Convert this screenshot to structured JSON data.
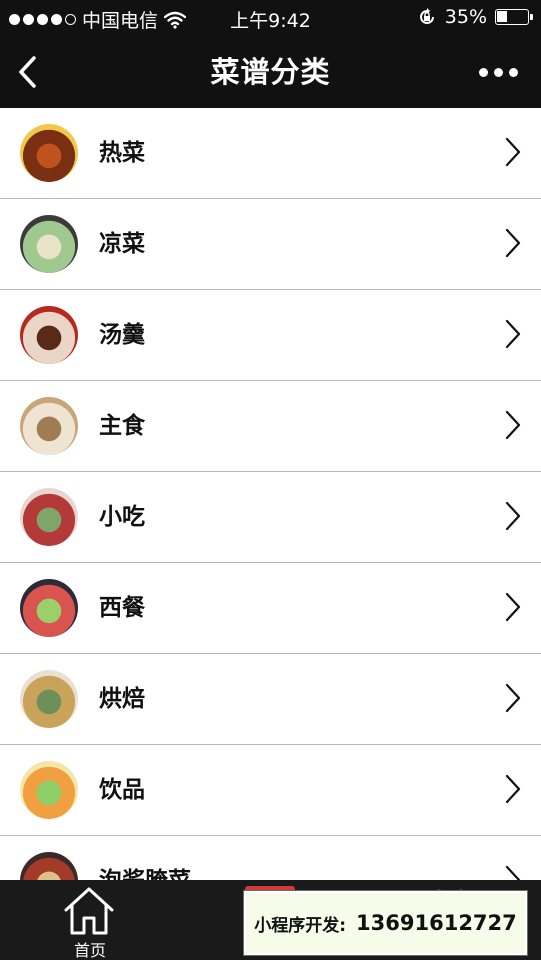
{
  "status_bar": {
    "carrier": "中国电信",
    "time": "上午9:42",
    "battery": "35%",
    "battery_level": 0.35
  },
  "nav": {
    "title": "菜谱分类",
    "back_icon": "chevron-left-icon",
    "more_icon": "more-dots-icon"
  },
  "categories": [
    {
      "label": "热菜",
      "thumb_colors": [
        "#f2c84b",
        "#7a2e12",
        "#c0521e"
      ]
    },
    {
      "label": "凉菜",
      "thumb_colors": [
        "#3b3b3b",
        "#9fc98f",
        "#e9e4c7"
      ]
    },
    {
      "label": "汤羹",
      "thumb_colors": [
        "#b8281d",
        "#e9d6c7",
        "#5a2a18"
      ]
    },
    {
      "label": "主食",
      "thumb_colors": [
        "#c9a57a",
        "#efe4d2",
        "#a07c52"
      ]
    },
    {
      "label": "小吃",
      "thumb_colors": [
        "#e8d7d0",
        "#b43a3a",
        "#7fa66a"
      ]
    },
    {
      "label": "西餐",
      "thumb_colors": [
        "#2b2b3b",
        "#d9534f",
        "#9ccf6a"
      ]
    },
    {
      "label": "烘焙",
      "thumb_colors": [
        "#e8e0d0",
        "#c9a35a",
        "#6e8f5a"
      ]
    },
    {
      "label": "饮品",
      "thumb_colors": [
        "#f2e7a5",
        "#f0a040",
        "#8fcf6a"
      ]
    },
    {
      "label": "泡酱腌菜",
      "thumb_colors": [
        "#3a2a2a",
        "#a33a2a",
        "#e0c08a"
      ]
    }
  ],
  "tab_bar": {
    "home_label": "首页",
    "home_icon": "home-icon"
  },
  "promo": {
    "label": "小程序开发:",
    "phone": "13691612727"
  }
}
